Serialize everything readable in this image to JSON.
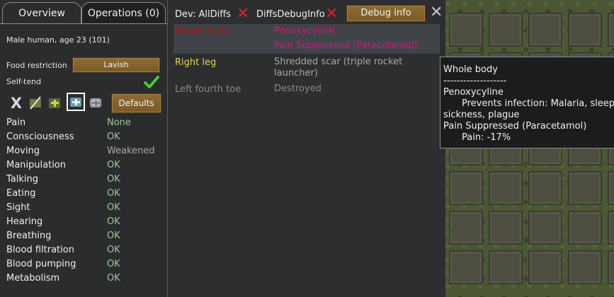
{
  "tabs": {
    "overview": "Overview",
    "operations": "Operations (0)"
  },
  "pawn_summary": "Male human, age 23 (101)",
  "food_restriction": {
    "label": "Food restriction",
    "value": "Lavish"
  },
  "self_tend": {
    "label": "Self-tend",
    "checked": true
  },
  "bill_buttons": {
    "icons": [
      "clear-bills-icon",
      "medicine-none-icon",
      "herbal-medicine-icon",
      "industrial-medicine-icon",
      "glitterworld-medicine-icon"
    ],
    "selected_index": 3,
    "defaults_label": "Defaults",
    "clear_glyph": "X"
  },
  "capacities": [
    {
      "name": "Pain",
      "value": "None"
    },
    {
      "name": "Consciousness",
      "value": "OK"
    },
    {
      "name": "Moving",
      "value": "Weakened"
    },
    {
      "name": "Manipulation",
      "value": "OK"
    },
    {
      "name": "Talking",
      "value": "OK"
    },
    {
      "name": "Eating",
      "value": "OK"
    },
    {
      "name": "Sight",
      "value": "OK"
    },
    {
      "name": "Hearing",
      "value": "OK"
    },
    {
      "name": "Breathing",
      "value": "OK"
    },
    {
      "name": "Blood filtration",
      "value": "OK"
    },
    {
      "name": "Blood pumping",
      "value": "OK"
    },
    {
      "name": "Metabolism",
      "value": "OK"
    }
  ],
  "dev": {
    "all_diffs_label": "Dev: AllDiffs",
    "diffs_debug_label": "DiffsDebugInfo",
    "debug_info_button": "Debug info",
    "x_glyph": "✕",
    "close_glyph": "✕"
  },
  "health_rows": [
    {
      "part": "Whole body",
      "conditions": [
        "Penoxycyline",
        "Pain Suppressed (Paracetamol)"
      ],
      "part_color": "#b01616",
      "cond_color": "#d0197a",
      "highlighted": true
    },
    {
      "part": "Right leg",
      "conditions": [
        "Shredded scar (triple rocket launcher)"
      ],
      "part_color": "#e6d64a",
      "cond_color": "#a8a8a8",
      "highlighted": false
    },
    {
      "part": "Left fourth toe",
      "conditions": [
        "Destroyed"
      ],
      "part_color": "#8a8a8a",
      "cond_color": "#8a8a8a",
      "highlighted": false
    }
  ],
  "tooltip": {
    "title": "Whole body",
    "separator": "-------------------",
    "items": [
      {
        "name": "Penoxycyline",
        "detail": "Prevents infection: Malaria, sleeping"
      },
      {
        "name": "",
        "detail": "sickness, plague"
      },
      {
        "name": "Pain Suppressed (Paracetamol)",
        "detail": "Pain: -17%"
      }
    ]
  },
  "colors": {
    "ok": "#9fc994",
    "wood": "#8f6b32",
    "panel": "#2a2c2e",
    "alert_red": "#e22020",
    "check_green": "#3fcf2f"
  }
}
